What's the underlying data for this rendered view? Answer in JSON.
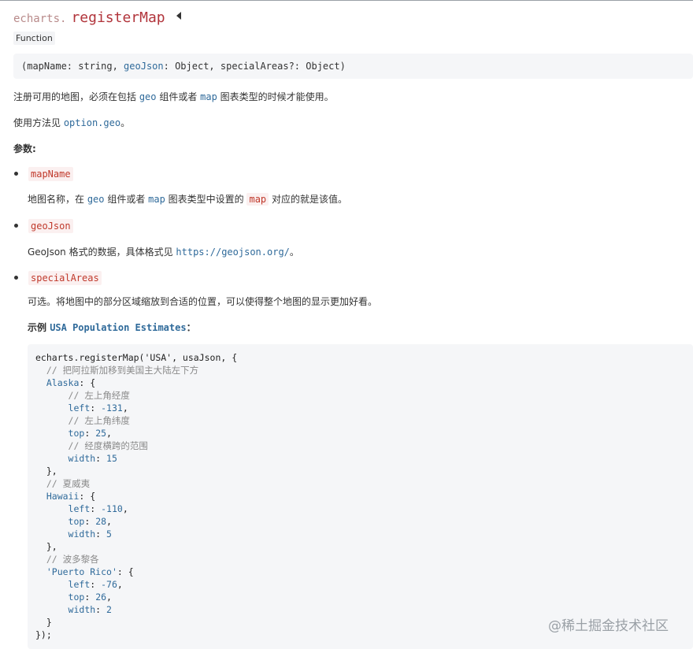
{
  "title": {
    "prefix": "echarts.",
    "name": "registerMap"
  },
  "badge": "Function",
  "signature": {
    "open": "(mapName: string, ",
    "param": "geoJson",
    "close": ": Object, specialAreas?: Object)"
  },
  "intro": {
    "text1": "注册可用的地图，必须在包括 ",
    "code1": "geo",
    "text2": " 组件或者 ",
    "code2": "map",
    "text3": " 图表类型的时候才能使用。"
  },
  "usage": {
    "text": "使用方法见 ",
    "link": "option.geo",
    "end": "。"
  },
  "params_heading": "参数:",
  "params": [
    {
      "name": "mapName",
      "desc": {
        "t1": "地图名称，在 ",
        "c1": "geo",
        "t2": " 组件或者 ",
        "c2": "map",
        "t3": " 图表类型中设置的 ",
        "c3": "map",
        "t4": " 对应的就是该值。"
      }
    },
    {
      "name": "geoJson",
      "desc": {
        "t1": "GeoJson 格式的数据，具体格式见 ",
        "link": "https://geojson.org/",
        "t2": "。"
      }
    },
    {
      "name": "specialAreas",
      "desc": {
        "t1": "可选。将地图中的部分区域缩放到合适的位置，可以使得整个地图的显示更加好看。"
      }
    }
  ],
  "example": {
    "label": "示例 ",
    "link": "USA Population Estimates",
    "colon": "："
  },
  "code": {
    "l1": "echarts.registerMap('USA', usaJson, {",
    "l2": "// 把阿拉斯加移到美国主大陆左下方",
    "l3k": "Alaska",
    "l3r": ": {",
    "l4": "// 左上角经度",
    "l5k": "left",
    "l5v": "-131",
    "l6": "// 左上角纬度",
    "l7k": "top",
    "l7v": "25",
    "l8": "// 经度横跨的范围",
    "l9k": "width",
    "l9v": "15",
    "l10": "},",
    "l11": "// 夏威夷",
    "l12k": "Hawaii",
    "l12r": ": {",
    "l13k": "left",
    "l13v": "-110",
    "l14k": "top",
    "l14v": "28",
    "l15k": "width",
    "l15v": "5",
    "l16": "},",
    "l17": "// 波多黎各",
    "l18k": "'Puerto Rico'",
    "l18r": ": {",
    "l19k": "left",
    "l19v": "-76",
    "l20k": "top",
    "l20v": "26",
    "l21k": "width",
    "l21v": "2",
    "l22": "}",
    "l23": "});"
  },
  "watermark": "@稀土掘金技术社区"
}
